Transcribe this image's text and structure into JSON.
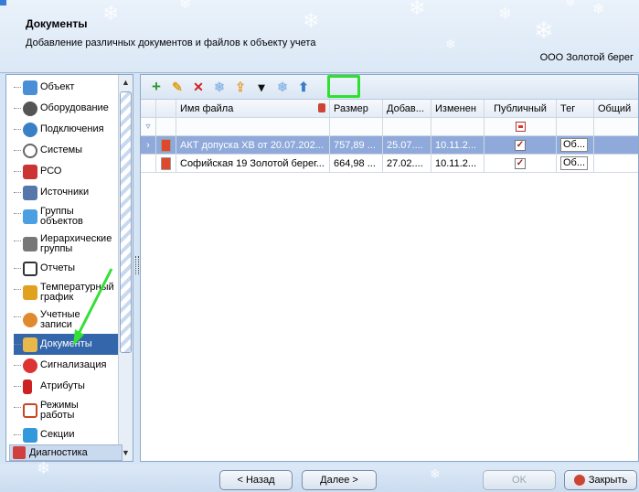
{
  "header": {
    "title": "Документы",
    "subtitle": "Добавление различных документов и файлов к объекту учета",
    "org": "ООО Золотой берег"
  },
  "sidebar": {
    "items": [
      {
        "label": "Объект",
        "icon": "house-icon",
        "color": "#4a8fd6"
      },
      {
        "label": "Оборудование",
        "icon": "gauge-icon",
        "color": "#555555"
      },
      {
        "label": "Подключения",
        "icon": "globe-icon",
        "color": "#3b7fc4"
      },
      {
        "label": "Системы",
        "icon": "meter-icon",
        "color": "#666666"
      },
      {
        "label": "РСО",
        "icon": "building-icon",
        "color": "#cc3333"
      },
      {
        "label": "Источники",
        "icon": "factory-icon",
        "color": "#5577aa"
      },
      {
        "label": "Группы объектов",
        "icon": "group-icon",
        "color": "#4aa0e0"
      },
      {
        "label": "Иерархические группы",
        "icon": "hierarchy-icon",
        "color": "#777777"
      },
      {
        "label": "Отчеты",
        "icon": "report-icon",
        "color": "#333333"
      },
      {
        "label": "Температурный график",
        "icon": "chart-icon",
        "color": "#e0a020"
      },
      {
        "label": "Учетные записи",
        "icon": "user-icon",
        "color": "#e08a30"
      },
      {
        "label": "Документы",
        "icon": "folder-icon",
        "color": "#e8b84a"
      },
      {
        "label": "Сигнализация",
        "icon": "alarm-icon",
        "color": "#dd3333"
      },
      {
        "label": "Атрибуты",
        "icon": "attribute-icon",
        "color": "#cc2222"
      },
      {
        "label": "Режимы работы",
        "icon": "calendar-icon",
        "color": "#cc4422"
      },
      {
        "label": "Секции",
        "icon": "sections-icon",
        "color": "#3399dd"
      }
    ],
    "diagnostics": "Диагностика"
  },
  "toolbar": {
    "add": "+",
    "edit": "✎",
    "delete": "✕",
    "refresh1": "❄",
    "open": "⇪",
    "save": "▾",
    "refresh2": "❄",
    "upload": "⬆"
  },
  "table": {
    "headers": {
      "name": "Имя файла",
      "size": "Размер",
      "added": "Добав...",
      "changed": "Изменен",
      "public": "Публичный",
      "tag": "Тег",
      "common": "Общий"
    },
    "rows": [
      {
        "name": "АКТ допуска ХВ от 20.07.202...",
        "size": "757,89 ...",
        "added": "25.07....",
        "changed": "10.11.2...",
        "public": "✓",
        "tag": "Об..."
      },
      {
        "name": "Софийская 19 Золотой берег...",
        "size": "664,98 ...",
        "added": "27.02....",
        "changed": "10.11.2...",
        "public": "✓",
        "tag": "Об..."
      }
    ]
  },
  "footer": {
    "back": "< Назад",
    "next": "Далее >",
    "ok": "OK",
    "close": "Закрыть"
  }
}
